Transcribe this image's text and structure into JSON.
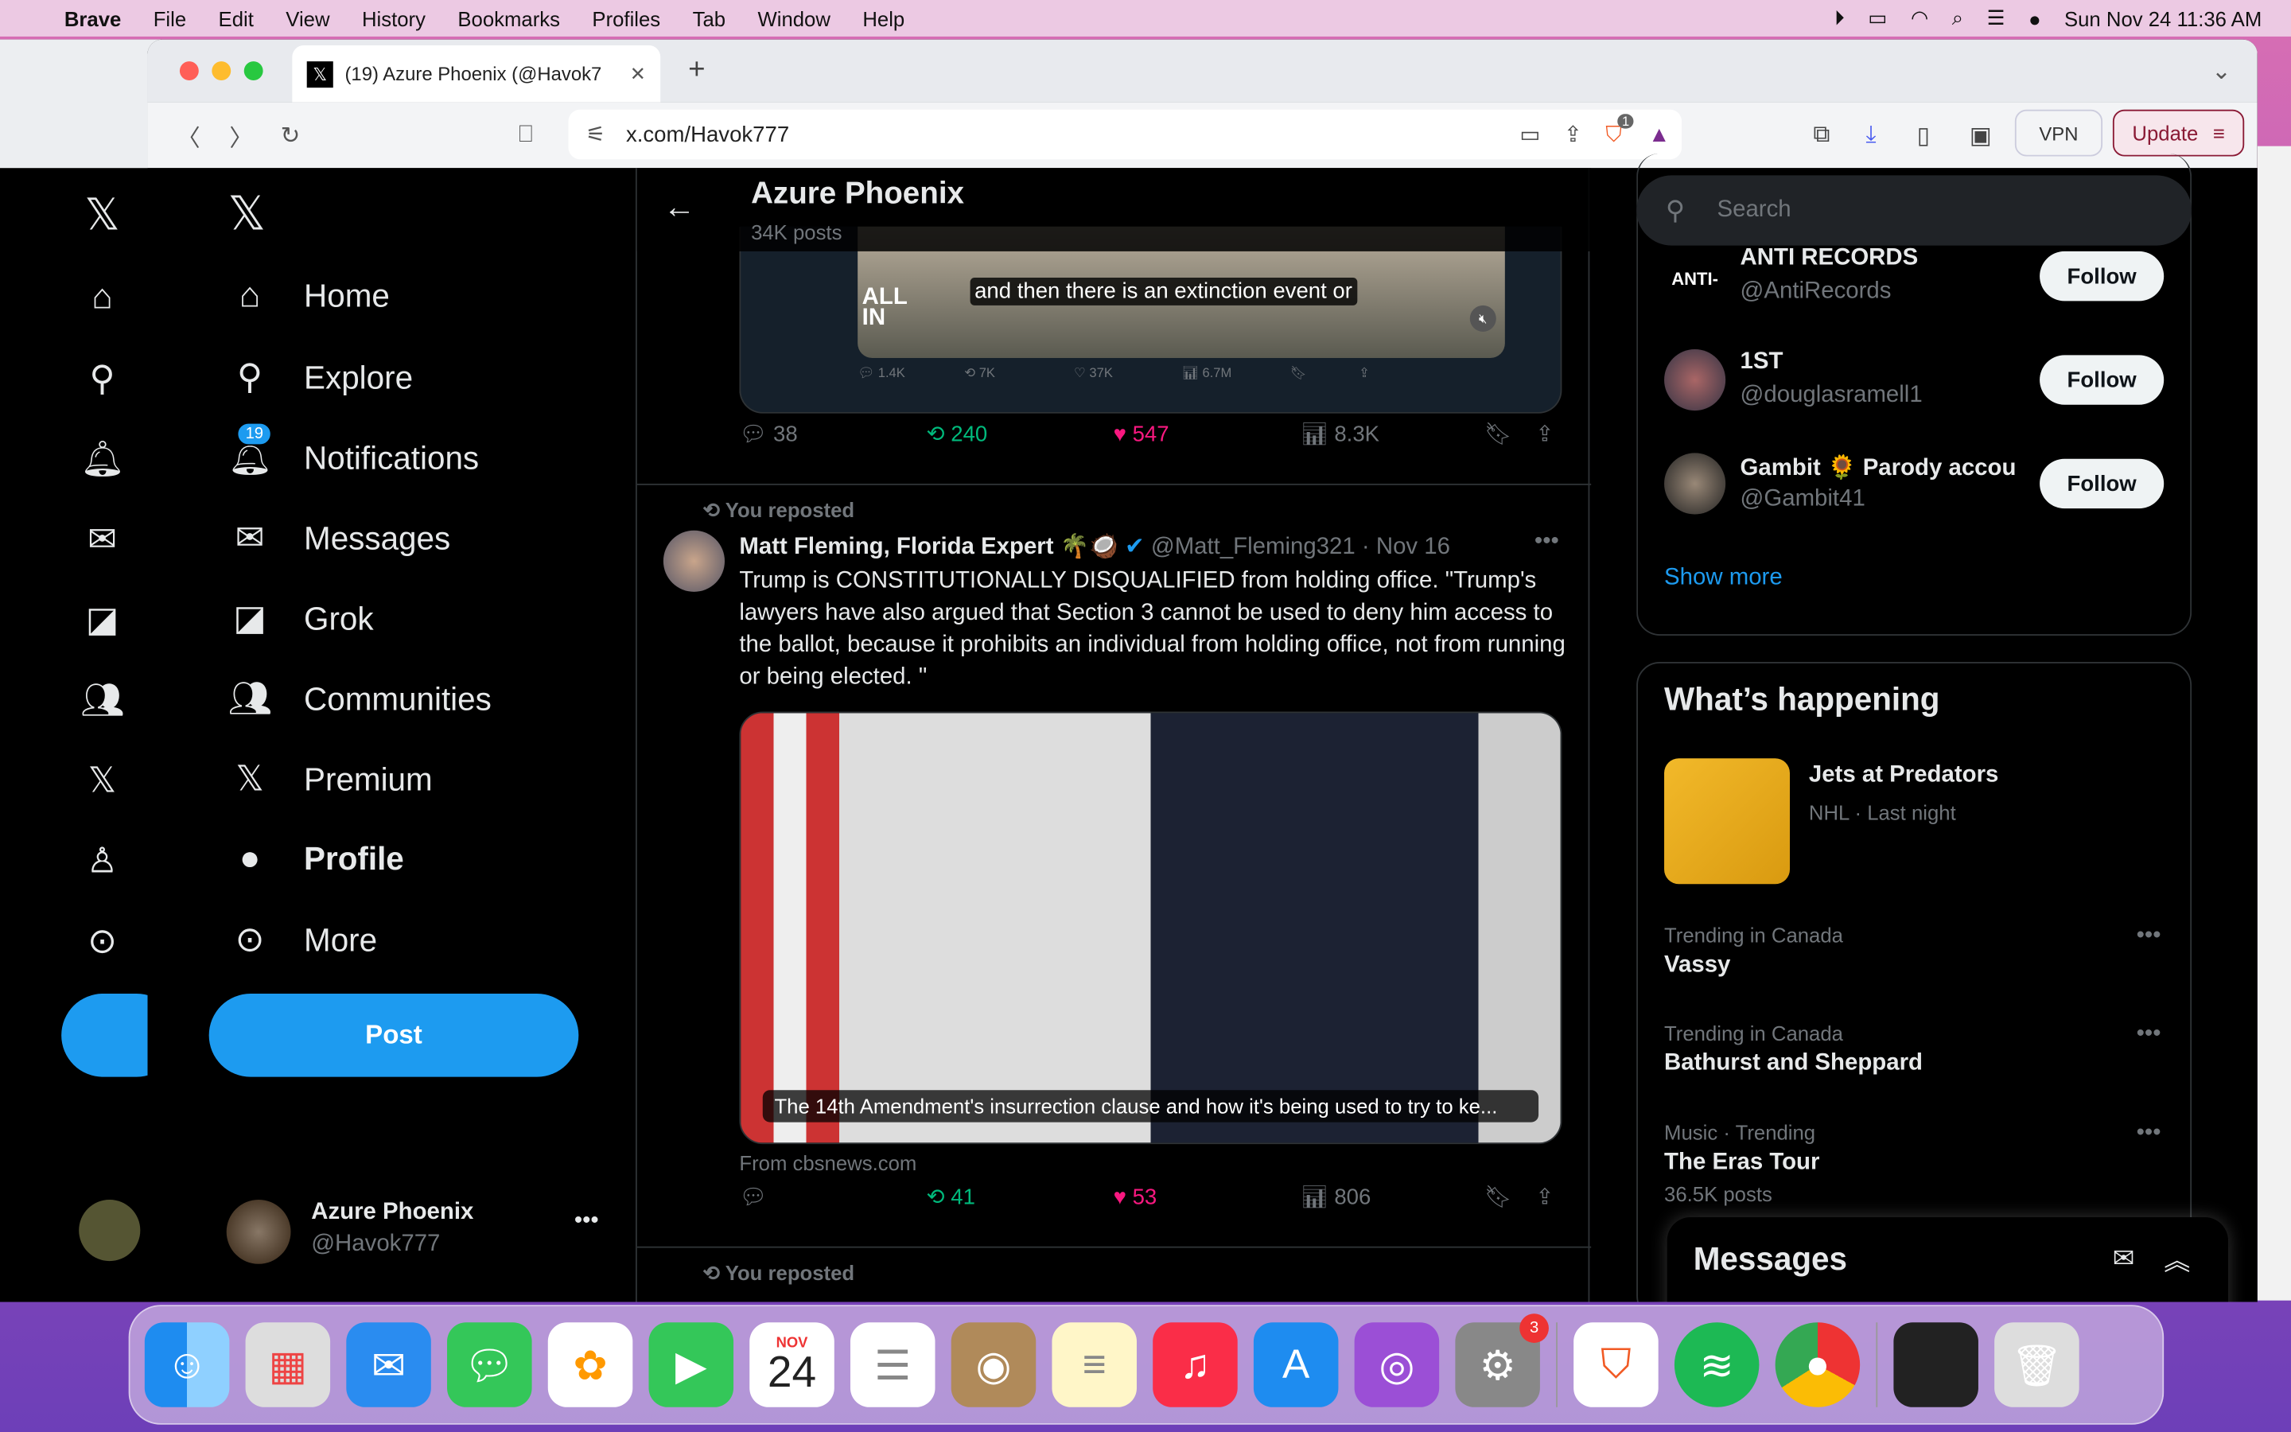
{
  "menubar": {
    "app": "Brave",
    "items": [
      "File",
      "Edit",
      "View",
      "History",
      "Bookmarks",
      "Profiles",
      "Tab",
      "Window",
      "Help"
    ],
    "datetime": "Sun Nov 24  11:36 AM"
  },
  "browser": {
    "tab_title": "(19) Azure Phoenix (@Havok7",
    "url": "x.com/Havok777",
    "vpn": "VPN",
    "update": "Update",
    "shields_count": "1"
  },
  "nav": {
    "items": [
      {
        "label": "Home",
        "icon": "home-icon"
      },
      {
        "label": "Explore",
        "icon": "search-icon"
      },
      {
        "label": "Notifications",
        "icon": "bell-icon",
        "badge": "19"
      },
      {
        "label": "Messages",
        "icon": "mail-icon"
      },
      {
        "label": "Grok",
        "icon": "grok-icon"
      },
      {
        "label": "Communities",
        "icon": "people-icon"
      },
      {
        "label": "Premium",
        "icon": "x-icon"
      },
      {
        "label": "Profile",
        "icon": "person-icon"
      },
      {
        "label": "More",
        "icon": "more-icon"
      }
    ],
    "post": "Post",
    "account_name": "Azure Phoenix",
    "account_handle": "@Havok777"
  },
  "header": {
    "title": "Azure Phoenix",
    "posts": "34K posts"
  },
  "quoted": {
    "caption": "and then there is an extinction event or",
    "logo": "ALL IN",
    "replies": "1.4K",
    "reposts": "7K",
    "likes": "37K",
    "views": "6.7M"
  },
  "post1": {
    "replies": "38",
    "reposts": "240",
    "likes": "547",
    "views": "8.3K"
  },
  "post2": {
    "repost_label": "You reposted",
    "author": "Matt Fleming, Florida Expert 🌴🥥",
    "handle": "@Matt_Fleming321",
    "date": "· Nov 16",
    "text": "Trump is CONSTITUTIONALLY DISQUALIFIED from holding office. \"Trump's lawyers have also argued that Section 3 cannot be used to deny him access to the ballot, because it prohibits an individual from holding office, not from running or being elected. \"",
    "card_title": "The 14th Amendment's insurrection clause and how it's being used to try to ke...",
    "source": "From cbsnews.com",
    "reposts": "41",
    "likes": "53",
    "views": "806"
  },
  "post3": {
    "repost_label": "You reposted"
  },
  "search": {
    "placeholder": "Search"
  },
  "who_to_follow": {
    "accounts": [
      {
        "name": "ANTI RECORDS",
        "handle": "@AntiRecords",
        "logo": "ANTI-"
      },
      {
        "name": "1ST",
        "handle": "@douglasramell1"
      },
      {
        "name": "Gambit 🌻 Parody accou",
        "handle": "@Gambit41"
      }
    ],
    "follow": "Follow",
    "show_more": "Show more"
  },
  "happening": {
    "title": "What’s happening",
    "event": {
      "title": "Jets at Predators",
      "meta": "NHL · Last night"
    },
    "trends": [
      {
        "context": "Trending in Canada",
        "name": "Vassy"
      },
      {
        "context": "Trending in Canada",
        "name": "Bathurst and Sheppard"
      },
      {
        "context": "Music · Trending",
        "name": "The Eras Tour",
        "count": "36.5K posts"
      }
    ]
  },
  "messages_drawer": {
    "title": "Messages"
  },
  "dock": {
    "calendar_month": "NOV",
    "calendar_day": "24",
    "settings_badge": "3"
  },
  "colors": {
    "accent": "#1d9bf0",
    "repost": "#00ba7c",
    "like": "#f91880"
  }
}
